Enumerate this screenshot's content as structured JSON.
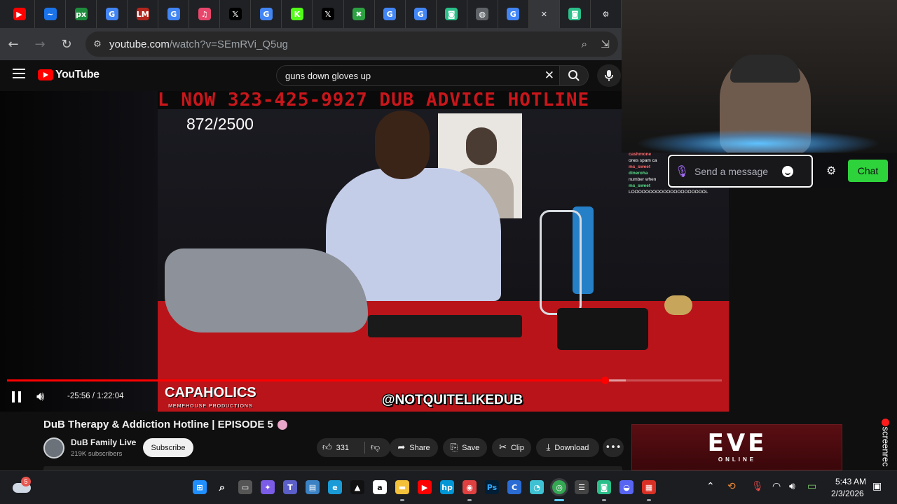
{
  "browser": {
    "tabs": [
      {
        "icon": "youtube-icon",
        "glyph": "▶",
        "color": "#ff0000"
      },
      {
        "icon": "blue-circle-icon",
        "glyph": "~",
        "color": "#1a73e8"
      },
      {
        "icon": "px-icon",
        "glyph": "px",
        "color": "#1e8e3e"
      },
      {
        "icon": "google-icon",
        "glyph": "G",
        "color": "#4285f4"
      },
      {
        "icon": "lm-icon",
        "glyph": "LM",
        "color": "#b3261e"
      },
      {
        "icon": "google-icon",
        "glyph": "G",
        "color": "#4285f4"
      },
      {
        "icon": "audio-icon",
        "glyph": "♫",
        "color": "#e8466b"
      },
      {
        "icon": "x-icon",
        "glyph": "𝕏",
        "color": "#000000"
      },
      {
        "icon": "google-icon",
        "glyph": "G",
        "color": "#4285f4"
      },
      {
        "icon": "kick-icon",
        "glyph": "K",
        "color": "#53fc18"
      },
      {
        "icon": "x-icon",
        "glyph": "𝕏",
        "color": "#000000"
      },
      {
        "icon": "xbox-icon",
        "glyph": "✖",
        "color": "#2ca243"
      },
      {
        "icon": "google-icon",
        "glyph": "G",
        "color": "#4285f4"
      },
      {
        "icon": "google-icon",
        "glyph": "G",
        "color": "#4285f4"
      },
      {
        "icon": "app-icon",
        "glyph": "◙",
        "color": "#2bbf8a"
      },
      {
        "icon": "globe-icon",
        "glyph": "◍",
        "color": "#5f6368"
      },
      {
        "icon": "google-icon",
        "glyph": "G",
        "color": "#4285f4"
      },
      {
        "icon": "close-icon",
        "glyph": "✕",
        "color": "#35363a"
      },
      {
        "icon": "app-icon",
        "glyph": "◙",
        "color": "#2bbf8a"
      },
      {
        "icon": "settings-icon",
        "glyph": "⚙",
        "color": "#5f6368"
      }
    ],
    "url_host": "youtube.com",
    "url_rest": "/watch?v=SEmRVi_Q5ug"
  },
  "youtube": {
    "logo_text": "YouTube",
    "search_value": "guns down gloves up",
    "video": {
      "ticker_text": "L NOW 323-425-9927   DUB ADVICE HOTLINE",
      "counter_text": "872/2500",
      "watermark_brand": "CAPAHOLICS",
      "watermark_brand_sub": "MEMEHOUSE PRODUCTIONS",
      "watermark_handle": "@NOTQUITELIKEDUB",
      "time_display": "-25:56 / 1:22:04",
      "progress_played": 0.836,
      "progress_buffered": 0.866
    },
    "title": "DuB Therapy & Addiction Hotline | EPISODE 5",
    "channel_name": "DuB Family Live",
    "channel_subs": "219K subscribers",
    "subscribe_label": "Subscribe",
    "like_count": "331",
    "share_label": "Share",
    "save_label": "Save",
    "clip_label": "Clip",
    "download_label": "Download"
  },
  "stream_overlay": {
    "chat_log": [
      {
        "user": "cashmone",
        "msg": ""
      },
      {
        "user": "",
        "msg": "ones spam ca"
      },
      {
        "user": "ms_sweet",
        "msg": ""
      },
      {
        "user": "dineroha",
        "msg": ""
      },
      {
        "user": "",
        "msg": "number when"
      },
      {
        "user": "ms_sweet",
        "msg": ""
      },
      {
        "user": "",
        "msg": "LOOOOOOOOOOOOOOOOOOOOOL"
      }
    ],
    "chat_placeholder": "Send a message",
    "chat_button": "Chat"
  },
  "ad": {
    "logo": "EVE",
    "sub": "ONLINE"
  },
  "screenrec_label": "screenrec",
  "taskbar": {
    "weather_badge": "5",
    "time": "5:43 AM",
    "date": "2/3/2026"
  }
}
